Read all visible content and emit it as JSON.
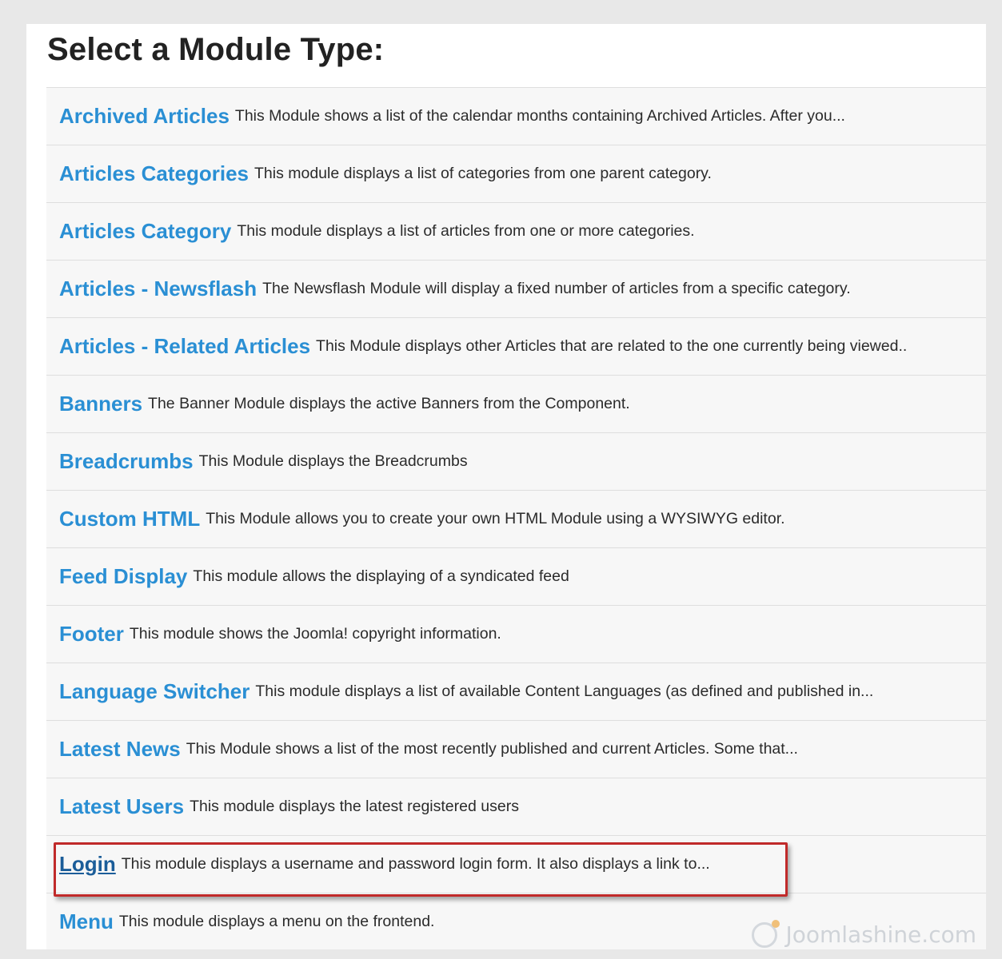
{
  "page": {
    "title": "Select a Module Type:"
  },
  "modules": [
    {
      "name": "Archived Articles",
      "description": "This Module shows a list of the calendar months containing Archived Articles. After you..."
    },
    {
      "name": "Articles Categories",
      "description": "This module displays a list of categories from one parent category."
    },
    {
      "name": "Articles Category",
      "description": "This module displays a list of articles from one or more categories."
    },
    {
      "name": "Articles - Newsflash",
      "description": "The Newsflash Module will display a fixed number of articles from a specific category."
    },
    {
      "name": "Articles - Related Articles",
      "description": "This Module displays other Articles that are related to the one currently being viewed.."
    },
    {
      "name": "Banners",
      "description": "The Banner Module displays the active Banners from the Component."
    },
    {
      "name": "Breadcrumbs",
      "description": "This Module displays the Breadcrumbs"
    },
    {
      "name": "Custom HTML",
      "description": "This Module allows you to create your own HTML Module using a WYSIWYG editor."
    },
    {
      "name": "Feed Display",
      "description": "This module allows the displaying of a syndicated feed"
    },
    {
      "name": "Footer",
      "description": "This module shows the Joomla! copyright information."
    },
    {
      "name": "Language Switcher",
      "description": "This module displays a list of available Content Languages (as defined and published in..."
    },
    {
      "name": "Latest News",
      "description": "This Module shows a list of the most recently published and current Articles. Some that..."
    },
    {
      "name": "Latest Users",
      "description": "This module displays the latest registered users"
    },
    {
      "name": "Login",
      "description": "This module displays a username and password login form. It also displays a link to..."
    },
    {
      "name": "Menu",
      "description": "This module displays a menu on the frontend."
    }
  ],
  "highlighted_module": "Login",
  "watermark": {
    "icon": "joomlashine-logo-icon",
    "text": "Joomlashine.com"
  },
  "colors": {
    "link": "#2a8fd4",
    "link_visited": "#1b5d99",
    "highlight_border": "#c02a2a",
    "row_background": "#f7f7f7"
  }
}
